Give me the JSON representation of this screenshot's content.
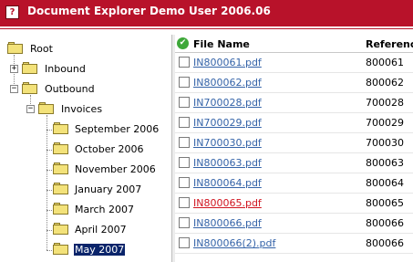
{
  "window": {
    "help_label": "?",
    "title": "Document Explorer Demo User 2006.06",
    "title_color": "#b8122a"
  },
  "tree": {
    "expanders": {
      "collapsed": "+",
      "expanded": "−"
    },
    "root": {
      "label": "Root",
      "icon": "folder-icon"
    },
    "inbound": {
      "label": "Inbound",
      "icon": "folder-icon",
      "state": "collapsed"
    },
    "outbound": {
      "label": "Outbound",
      "icon": "folder-icon",
      "state": "expanded"
    },
    "invoices": {
      "label": "Invoices",
      "icon": "folder-icon",
      "state": "expanded"
    },
    "months": [
      {
        "label": "September 2006"
      },
      {
        "label": "October 2006"
      },
      {
        "label": "November 2006"
      },
      {
        "label": "January 2007"
      },
      {
        "label": "March 2007"
      },
      {
        "label": "April 2007"
      },
      {
        "label": "May 2007",
        "selected": true
      }
    ],
    "selection_color": "#0a246a"
  },
  "grid": {
    "header": {
      "status_icon": "check-circle-icon",
      "file_name": "File Name",
      "reference": "Referenc"
    },
    "link_color": "#3463a8",
    "visited_link_color": "#d0141f",
    "rows": [
      {
        "file_name": "IN800061.pdf",
        "reference": "800061",
        "visited": false
      },
      {
        "file_name": "IN800062.pdf",
        "reference": "800062",
        "visited": false
      },
      {
        "file_name": "IN700028.pdf",
        "reference": "700028",
        "visited": false
      },
      {
        "file_name": "IN700029.pdf",
        "reference": "700029",
        "visited": false
      },
      {
        "file_name": "IN700030.pdf",
        "reference": "700030",
        "visited": false
      },
      {
        "file_name": "IN800063.pdf",
        "reference": "800063",
        "visited": false
      },
      {
        "file_name": "IN800064.pdf",
        "reference": "800064",
        "visited": false
      },
      {
        "file_name": "IN800065.pdf",
        "reference": "800065",
        "visited": true
      },
      {
        "file_name": "IN800066.pdf",
        "reference": "800066",
        "visited": false
      },
      {
        "file_name": "IN800066(2).pdf",
        "reference": "800066",
        "visited": false
      }
    ]
  }
}
